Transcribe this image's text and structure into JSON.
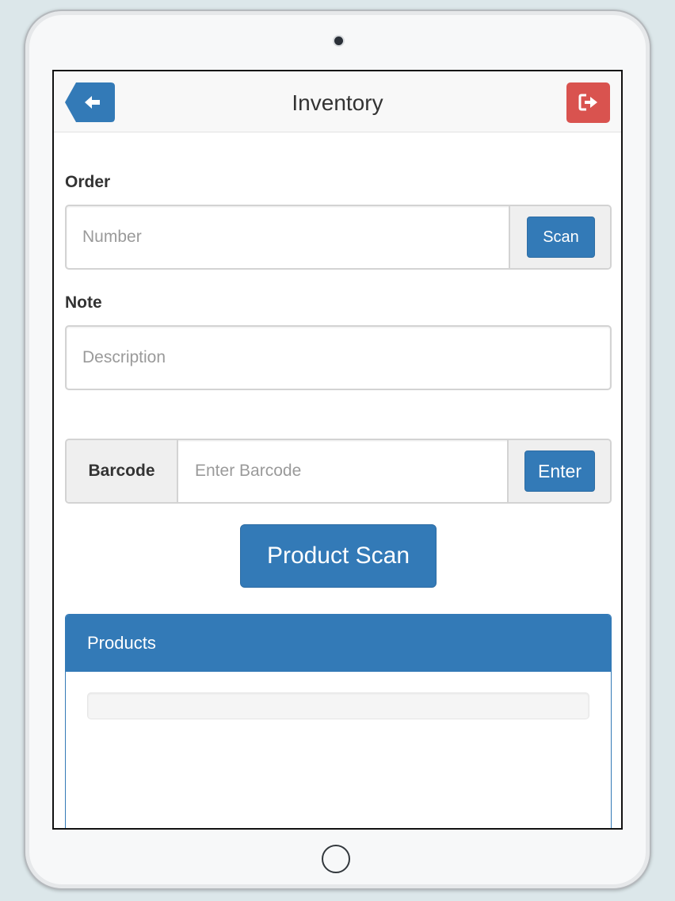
{
  "header": {
    "title": "Inventory",
    "back_icon": "arrow-left-icon",
    "logout_icon": "sign-out-icon"
  },
  "order": {
    "label": "Order",
    "placeholder": "Number",
    "scan_label": "Scan"
  },
  "note": {
    "label": "Note",
    "placeholder": "Description"
  },
  "barcode": {
    "label": "Barcode",
    "placeholder": "Enter Barcode",
    "enter_label": "Enter"
  },
  "product_scan_label": "Product Scan",
  "products": {
    "title": "Products"
  },
  "colors": {
    "primary": "#337ab7",
    "danger": "#d9534f"
  }
}
